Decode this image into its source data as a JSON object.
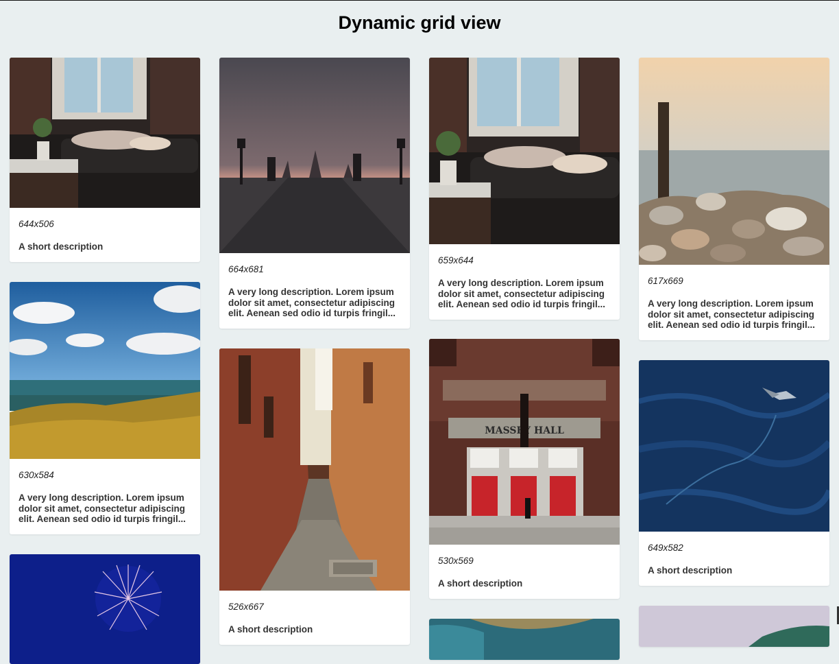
{
  "page": {
    "title": "Dynamic grid view"
  },
  "cards": [
    {
      "size": "644x506",
      "description": "A short description",
      "image": "woman-sleeping-on-sofa"
    },
    {
      "size": "630x584",
      "description": "A very long description. Lorem ipsum dolor sit amet, consectetur adipiscing elit. Aenean sed odio id turpis fringil...",
      "image": "sea-with-grass-and-clouds"
    },
    {
      "size": "",
      "description": "",
      "image": "fireworks"
    },
    {
      "size": "664x681",
      "description": "A very long description. Lorem ipsum dolor sit amet, consectetur adipiscing elit. Aenean sed odio id turpis fringil...",
      "image": "bridge-at-dusk"
    },
    {
      "size": "526x667",
      "description": "A short description",
      "image": "narrow-alley"
    },
    {
      "size": "659x644",
      "description": "A very long description. Lorem ipsum dolor sit amet, consectetur adipiscing elit. Aenean sed odio id turpis fringil...",
      "image": "woman-sleeping-on-sofa"
    },
    {
      "size": "530x569",
      "description": "A short description",
      "image": "massey-hall",
      "image_text": "MASSEY HALL"
    },
    {
      "size": "",
      "description": "",
      "image": "coastline-aerial"
    },
    {
      "size": "617x669",
      "description": "A very long description. Lorem ipsum dolor sit amet, consectetur adipiscing elit. Aenean sed odio id turpis fringil...",
      "image": "post-and-rocks-by-lake"
    },
    {
      "size": "649x582",
      "description": "A short description",
      "image": "ocean-water-with-bird"
    },
    {
      "size": "",
      "description": "",
      "image": "mountain-landscape"
    }
  ]
}
